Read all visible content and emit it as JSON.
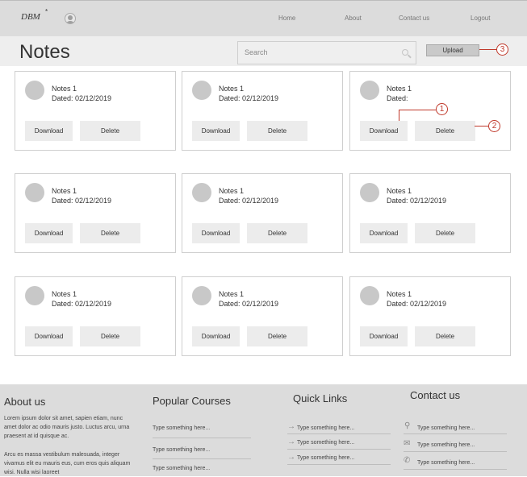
{
  "header": {
    "logo": "DBM",
    "logo_star": "*",
    "nav": [
      "Home",
      "About",
      "Contact us",
      "Logout"
    ]
  },
  "titlebar": {
    "title": "Notes",
    "search_placeholder": "Search",
    "upload_label": "Upload"
  },
  "notes": [
    {
      "title": "Notes 1",
      "date": "Dated: 02/12/2019"
    },
    {
      "title": "Notes 1",
      "date": "Dated: 02/12/2019"
    },
    {
      "title": "Notes 1",
      "date": "Dated:"
    },
    {
      "title": "Notes 1",
      "date": "Dated: 02/12/2019"
    },
    {
      "title": "Notes 1",
      "date": "Dated: 02/12/2019"
    },
    {
      "title": "Notes 1",
      "date": "Dated: 02/12/2019"
    },
    {
      "title": "Notes 1",
      "date": "Dated: 02/12/2019"
    },
    {
      "title": "Notes 1",
      "date": "Dated: 02/12/2019"
    },
    {
      "title": "Notes 1",
      "date": "Dated: 02/12/2019"
    }
  ],
  "buttons": {
    "download": "Download",
    "delete": "Delete"
  },
  "callouts": [
    "1",
    "2",
    "3"
  ],
  "footer": {
    "about": {
      "title": "About us",
      "p1": "Lorem ipsum dolor sit amet, sapien etiam, nunc amet dolor ac odio mauris justo. Luctus arcu, urna praesent at id quisque ac.",
      "p2": "Arcu es massa vestibulum malesuada, integer vivamus elit eu mauris eus, cum eros quis aliquam wisi. Nulla wisi laoreet"
    },
    "courses": {
      "title": "Popular Courses",
      "items": [
        "Type something here...",
        "Type something here...",
        "Type something here..."
      ]
    },
    "links": {
      "title": "Quick Links",
      "items": [
        "Type something here...",
        "Type something here...",
        "Type something here..."
      ]
    },
    "contact": {
      "title": "Contact us",
      "items": [
        "Type something here...",
        "Type something here...",
        "Type something here..."
      ]
    }
  },
  "colors": {
    "callout": "#c0392b",
    "header_bg": "#dcdcdc",
    "footer_bg": "#dcdcdc"
  }
}
